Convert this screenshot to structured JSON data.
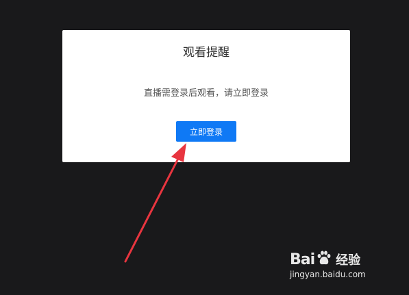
{
  "dialog": {
    "title": "观看提醒",
    "message": "直播需登录后观看，请立即登录",
    "login_button_label": "立即登录"
  },
  "colors": {
    "background": "#19191b",
    "dialog_background": "#ffffff",
    "button_accent": "#0f79f5",
    "annotation_arrow": "#e8353f",
    "watermark": "#e8e8e8"
  },
  "watermark": {
    "brand_prefix": "Bai",
    "brand_suffix": "经验",
    "domain": "jingyan.baidu.com",
    "icon": "baidu-paw-icon"
  }
}
